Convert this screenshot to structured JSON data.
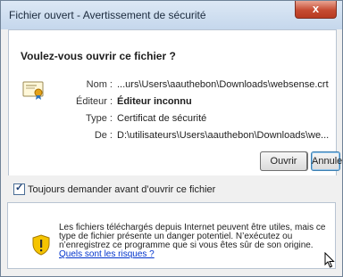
{
  "window": {
    "title": "Fichier ouvert - Avertissement de sécurité",
    "close_symbol": "x"
  },
  "dialog": {
    "question": "Voulez-vous ouvrir ce fichier ?",
    "fields": [
      {
        "label": "Nom :",
        "value": "...urs\\Users\\aauthebon\\Downloads\\websense.crt"
      },
      {
        "label": "Éditeur :",
        "value": "Éditeur inconnu"
      },
      {
        "label": "Type :",
        "value": "Certificat de sécurité"
      },
      {
        "label": "De :",
        "value": "D:\\utilisateurs\\Users\\aauthebon\\Downloads\\we..."
      }
    ],
    "open_label": "Ouvrir",
    "cancel_label": "Annuler",
    "checkbox_label": "Toujours demander avant d’ouvrir ce fichier",
    "checkbox_checked": true
  },
  "warning": {
    "text": "Les fichiers téléchargés depuis Internet peuvent être utiles, mais ce type de fichier présente un danger potentiel. N’exécutez ou n’enregistrez ce programme que si vous êtes sûr de son origine.",
    "link": "Quels sont les risques ?"
  },
  "icons": {
    "certificate": "certificate-icon",
    "shield": "shield-warning-icon",
    "cursor": "mouse-cursor-icon"
  },
  "colors": {
    "title_bar": "#c5d7ec",
    "close_button": "#c64b32",
    "shield_yellow": "#f5c400",
    "link": "#0033cc"
  }
}
